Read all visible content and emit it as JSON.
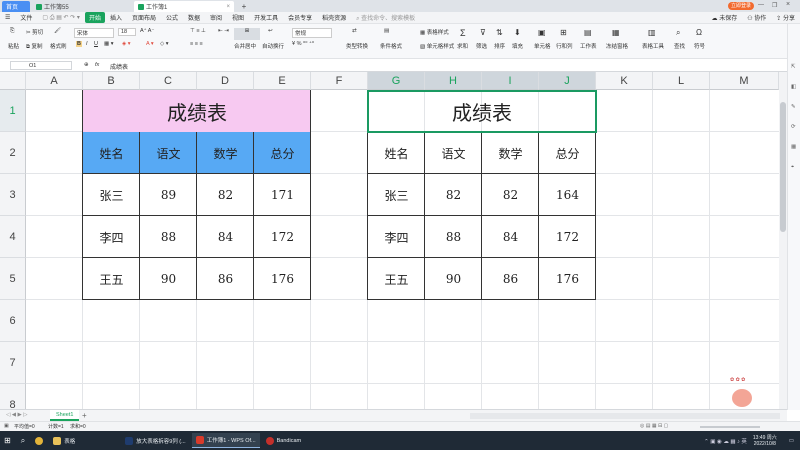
{
  "titlebar": {
    "tabs": [
      {
        "label": "首页"
      },
      {
        "label": "工作簿55"
      },
      {
        "label": "工作簿1"
      }
    ],
    "login_label": "立即登录",
    "share_label": "分享"
  },
  "menubar": {
    "file_label": "文件",
    "items": [
      "开始",
      "插入",
      "页面布局",
      "公式",
      "数据",
      "审阅",
      "视图",
      "开发工具",
      "会员专享",
      "稻壳资源"
    ],
    "active": "开始",
    "search_placeholder": "查找命令、搜索模板",
    "cloud_label": "未保存",
    "collab_label": "协作"
  },
  "ribbon": {
    "cut": "剪切",
    "copy": "复制",
    "format_painter": "格式刷",
    "paste": "粘贴",
    "font_name": "宋体",
    "font_size": "18",
    "bold": "B",
    "italic": "I",
    "underline": "U",
    "merge": "合并居中",
    "wrap": "自动换行",
    "number_format": "常规",
    "type_convert": "类型转换",
    "cond_format": "条件格式",
    "table_style": "表格样式",
    "cell_style": "单元格样式",
    "sum": "求和",
    "filter": "筛选",
    "sort": "排序",
    "fill": "填充",
    "cell": "单元格",
    "rowcol": "行和列",
    "sheet": "工作表",
    "freeze": "冻结窗格",
    "table_tools": "表格工具",
    "find": "查找",
    "symbol": "符号"
  },
  "formula": {
    "cell_ref": "O1",
    "fx": "fx",
    "content": "成绩表"
  },
  "columns": [
    "A",
    "B",
    "C",
    "D",
    "E",
    "F",
    "G",
    "H",
    "I",
    "J",
    "K",
    "L",
    "M"
  ],
  "rows": [
    "1",
    "2",
    "3",
    "4",
    "5",
    "6",
    "7",
    "8"
  ],
  "table_left": {
    "title": "成绩表",
    "headers": [
      "姓名",
      "语文",
      "数学",
      "总分"
    ],
    "rows": [
      [
        "张三",
        "89",
        "82",
        "171"
      ],
      [
        "李四",
        "88",
        "84",
        "172"
      ],
      [
        "王五",
        "90",
        "86",
        "176"
      ]
    ],
    "title_bg": "#f7c9f1",
    "header_bg": "#57a9f4"
  },
  "table_right": {
    "title": "成绩表",
    "headers": [
      "姓名",
      "语文",
      "数学",
      "总分"
    ],
    "rows": [
      [
        "张三",
        "82",
        "82",
        "164"
      ],
      [
        "李四",
        "88",
        "84",
        "172"
      ],
      [
        "王五",
        "90",
        "86",
        "176"
      ]
    ]
  },
  "sheetbar": {
    "sheet_name": "Sheet1",
    "add": "+"
  },
  "statusbar": {
    "avg": "平均值=0",
    "count": "计数=1",
    "sum": "求和=0"
  },
  "taskbar": {
    "apps": [
      {
        "label": "表格"
      },
      {
        "label": "放大表格拆容9列 (..."
      },
      {
        "label": "工作簿1 - WPS Of..."
      },
      {
        "label": "Bandicam"
      }
    ],
    "time": "13:49 周六",
    "date": "2022/10/8"
  },
  "colors": {
    "accent": "#1aa35d",
    "selection": "#1a9a62"
  }
}
